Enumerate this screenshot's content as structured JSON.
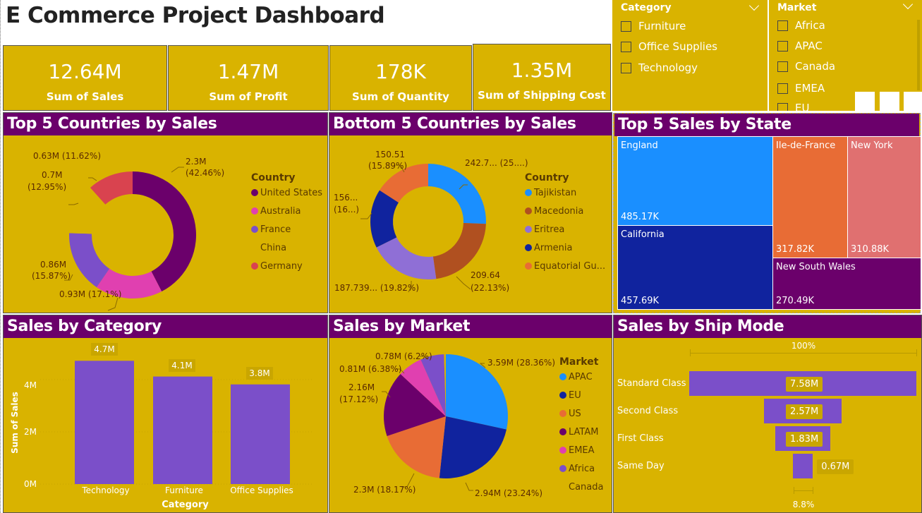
{
  "title": "E Commerce Project Dashboard",
  "kpis": [
    {
      "value": "12.64M",
      "label": "Sum of Sales"
    },
    {
      "value": "1.47M",
      "label": "Sum of Profit"
    },
    {
      "value": "178K",
      "label": "Sum of Quantity"
    },
    {
      "value": "1.35M",
      "label": "Sum of Shipping Cost"
    }
  ],
  "slicers": {
    "category": {
      "title": "Category",
      "items": [
        "Furniture",
        "Office Supplies",
        "Technology"
      ]
    },
    "market": {
      "title": "Market",
      "items": [
        "Africa",
        "APAC",
        "Canada",
        "EMEA",
        "EU"
      ]
    }
  },
  "top5_countries": {
    "title": "Top 5 Countries by Sales",
    "legend_title": "Country",
    "legend": [
      "United States",
      "Australia",
      "France",
      "China",
      "Germany"
    ],
    "labels": [
      "2.3M",
      "(42.46%)",
      "0.63M (11.62%)",
      "0.7M",
      "(12.95%)",
      "0.86M",
      "(15.87%)",
      "0.93M (17.1%)"
    ]
  },
  "bottom5_countries": {
    "title": "Bottom 5 Countries by Sales",
    "legend_title": "Country",
    "legend": [
      "Tajikistan",
      "Macedonia",
      "Eritrea",
      "Armenia",
      "Equatorial Gu..."
    ],
    "labels": [
      "242.7... (25....)",
      "150.51",
      "(15.89%)",
      "156...",
      "(16...)",
      "209.64",
      "(22.13%)",
      "187.739... (19.82%)"
    ]
  },
  "treemap": {
    "title": "Top 5 Sales by State",
    "cells": [
      {
        "name": "England",
        "value": "485.17K"
      },
      {
        "name": "California",
        "value": "457.69K"
      },
      {
        "name": "Ile-de-France",
        "value": "317.82K"
      },
      {
        "name": "New York",
        "value": "310.88K"
      },
      {
        "name": "New South Wales",
        "value": "270.49K"
      }
    ]
  },
  "sales_by_category": {
    "title": "Sales by Category",
    "xlabel": "Category",
    "ylabel": "Sum of Sales",
    "yticks": [
      "4M",
      "2M",
      "0M"
    ],
    "bars": [
      {
        "category": "Technology",
        "label": "4.7M"
      },
      {
        "category": "Furniture",
        "label": "4.1M"
      },
      {
        "category": "Office Supplies",
        "label": "3.8M"
      }
    ]
  },
  "sales_by_market": {
    "title": "Sales by Market",
    "legend_title": "Market",
    "legend": [
      "APAC",
      "EU",
      "US",
      "LATAM",
      "EMEA",
      "Africa",
      "Canada"
    ],
    "labels": [
      "3.59M (28.36%)",
      "2.94M (23.24%)",
      "2.3M (18.17%)",
      "2.16M",
      "(17.12%)",
      "0.81M (6.38%)",
      "0.78M (6.2%)"
    ]
  },
  "ship_mode": {
    "title": "Sales by Ship Mode",
    "top_pct": "100%",
    "bottom_pct": "8.8%",
    "rows": [
      {
        "mode": "Standard Class",
        "label": "7.58M"
      },
      {
        "mode": "Second Class",
        "label": "2.57M"
      },
      {
        "mode": "First Class",
        "label": "1.83M"
      },
      {
        "mode": "Same Day",
        "label": "0.67M"
      }
    ]
  },
  "chart_data": [
    {
      "type": "pie",
      "title": "Top 5 Countries by Sales",
      "categories": [
        "United States",
        "Australia",
        "France",
        "China",
        "Germany"
      ],
      "values": [
        2.3,
        0.93,
        0.86,
        0.7,
        0.63
      ],
      "percents": [
        42.46,
        17.1,
        15.87,
        12.95,
        11.62
      ],
      "colors": [
        "#6b006b",
        "#e040b0",
        "#7b4fc9",
        "#d9b300",
        "#d9434f"
      ],
      "donut": true,
      "legend": "right"
    },
    {
      "type": "pie",
      "title": "Bottom 5 Countries by Sales",
      "categories": [
        "Tajikistan",
        "Macedonia",
        "Eritrea",
        "Armenia",
        "Equatorial Gu..."
      ],
      "values": [
        242.7,
        209.64,
        187.739,
        156,
        150.51
      ],
      "percents": [
        25,
        22.13,
        19.82,
        16,
        15.89
      ],
      "colors": [
        "#1a8fff",
        "#b05020",
        "#8f6fd6",
        "#10239e",
        "#e86c35"
      ],
      "donut": true,
      "legend": "right"
    },
    {
      "type": "bar",
      "title": "Sales by Category",
      "categories": [
        "Technology",
        "Furniture",
        "Office Supplies"
      ],
      "values": [
        4.7,
        4.1,
        3.8
      ],
      "xlabel": "Category",
      "ylabel": "Sum of Sales",
      "ylim": [
        0,
        5
      ],
      "color": "#7b4fc9"
    },
    {
      "type": "pie",
      "title": "Sales by Market",
      "categories": [
        "APAC",
        "EU",
        "US",
        "LATAM",
        "EMEA",
        "Africa",
        "Canada"
      ],
      "values": [
        3.59,
        2.94,
        2.3,
        2.16,
        0.81,
        0.78,
        0.06
      ],
      "percents": [
        28.36,
        23.24,
        18.17,
        17.12,
        6.38,
        6.2,
        0.5
      ],
      "colors": [
        "#1a8fff",
        "#10239e",
        "#e86c35",
        "#6b006b",
        "#e040b0",
        "#7b4fc9",
        "#d9b300"
      ],
      "legend": "right"
    },
    {
      "type": "bar",
      "title": "Sales by Ship Mode",
      "categories": [
        "Standard Class",
        "Second Class",
        "First Class",
        "Same Day"
      ],
      "values": [
        7.58,
        2.57,
        1.83,
        0.67
      ],
      "color": "#7b4fc9"
    }
  ]
}
